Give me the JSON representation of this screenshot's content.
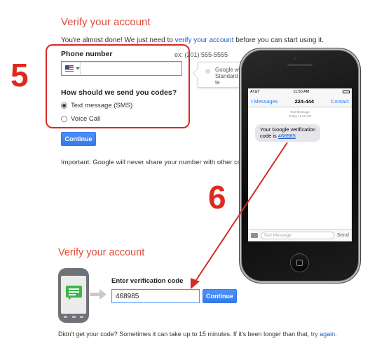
{
  "step5": {
    "number": "5",
    "title": "Verify your account",
    "intro_prefix": "You're almost done! We just need to ",
    "intro_link": "verify your account",
    "intro_suffix": " before you can start using it.",
    "phone_label": "Phone number",
    "phone_hint": "ex: (201) 555-5555",
    "phone_value": "",
    "country_flag": "us-flag-icon",
    "method_label": "How should we send you codes?",
    "options": [
      {
        "label": "Text message (SMS)",
        "checked": true
      },
      {
        "label": "Voice Call",
        "checked": false
      }
    ],
    "tooltip_line1": "Google will",
    "tooltip_line2": "Standard te",
    "continue_label": "Continue",
    "important": "Important: Google will never share your number with other comp"
  },
  "phone_device": {
    "carrier": "AT&T",
    "time": "11:50 AM",
    "back_label": "Messages",
    "contact_number": "224-444",
    "contact_label": "Contact",
    "timestamp_line1": "Text Message",
    "timestamp_line2": "Today 11:50 AM",
    "message_line1": "Your Google verification",
    "message_line2_prefix": "code is ",
    "message_code": "468985",
    "composer_placeholder": "Text Message",
    "send_label": "Send"
  },
  "step6": {
    "number": "6",
    "title": "Verify your account",
    "code_label": "Enter verification code",
    "code_value": "468985",
    "continue_label": "Continue",
    "footer_prefix": "Didn't get your code? Sometimes it can take up to 15 minutes. If it's been longer than that, ",
    "footer_link": "try again",
    "footer_suffix": "."
  },
  "colors": {
    "accent_red": "#dd4b39",
    "annotation_red": "#d62b24",
    "button_blue": "#4d90fe",
    "link_blue": "#1a5dc7",
    "sms_bubble_green": "#3db54a"
  }
}
